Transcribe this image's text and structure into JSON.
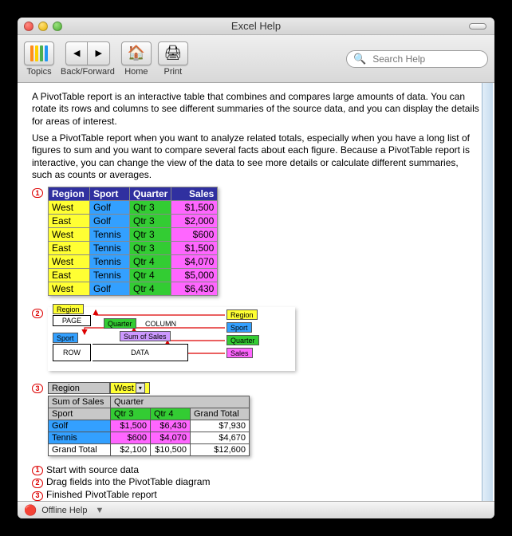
{
  "window": {
    "title": "Excel Help"
  },
  "toolbar": {
    "topics_label": "Topics",
    "backforward_label": "Back/Forward",
    "home_label": "Home",
    "print_label": "Print"
  },
  "search": {
    "placeholder": "Search Help"
  },
  "body": {
    "para1": "A PivotTable report is an interactive table that combines and compares large amounts of data. You can rotate its rows and columns to see different summaries of the source data, and you can display the details for areas of interest.",
    "para2": "Use a PivotTable report when you want to analyze related totals, especially when you have a long list of figures to sum and you want to compare several facts about each figure. Because a PivotTable report is interactive, you can change the view of the data to see more details or calculate different summaries, such as counts or averages."
  },
  "source_table": {
    "headers": {
      "region": "Region",
      "sport": "Sport",
      "quarter": "Quarter",
      "sales": "Sales"
    },
    "rows": [
      {
        "region": "West",
        "sport": "Golf",
        "quarter": "Qtr 3",
        "sales": "$1,500"
      },
      {
        "region": "East",
        "sport": "Golf",
        "quarter": "Qtr 3",
        "sales": "$2,000"
      },
      {
        "region": "West",
        "sport": "Tennis",
        "quarter": "Qtr 3",
        "sales": "$600"
      },
      {
        "region": "East",
        "sport": "Tennis",
        "quarter": "Qtr 3",
        "sales": "$1,500"
      },
      {
        "region": "West",
        "sport": "Tennis",
        "quarter": "Qtr 4",
        "sales": "$4,070"
      },
      {
        "region": "East",
        "sport": "Tennis",
        "quarter": "Qtr 4",
        "sales": "$5,000"
      },
      {
        "region": "West",
        "sport": "Golf",
        "quarter": "Qtr 4",
        "sales": "$6,430"
      }
    ]
  },
  "diagram": {
    "page_chip": "Region",
    "page_label": "PAGE",
    "column_chip": "Quarter",
    "column_label": "COLUMN",
    "row_chip": "Sport",
    "row_label": "ROW",
    "data_chip": "Sum of Sales",
    "data_label": "DATA",
    "side": {
      "region": "Region",
      "sport": "Sport",
      "quarter": "Quarter",
      "sales": "Sales"
    }
  },
  "pivot": {
    "page_field": "Region",
    "page_value": "West",
    "sum_label": "Sum of Sales",
    "col_field": "Quarter",
    "row_field": "Sport",
    "cols": {
      "q3": "Qtr 3",
      "q4": "Qtr 4",
      "gt": "Grand Total"
    },
    "rows": [
      {
        "label": "Golf",
        "q3": "$1,500",
        "q4": "$6,430",
        "gt": "$7,930"
      },
      {
        "label": "Tennis",
        "q3": "$600",
        "q4": "$4,070",
        "gt": "$4,670"
      }
    ],
    "total": {
      "label": "Grand Total",
      "q3": "$2,100",
      "q4": "$10,500",
      "gt": "$12,600"
    }
  },
  "legend": {
    "l1": "Start with source data",
    "l2": "Drag fields into the PivotTable diagram",
    "l3": "Finished PivotTable report"
  },
  "status": {
    "label": "Offline Help"
  },
  "badges": {
    "b1": "1",
    "b2": "2",
    "b3": "3"
  }
}
